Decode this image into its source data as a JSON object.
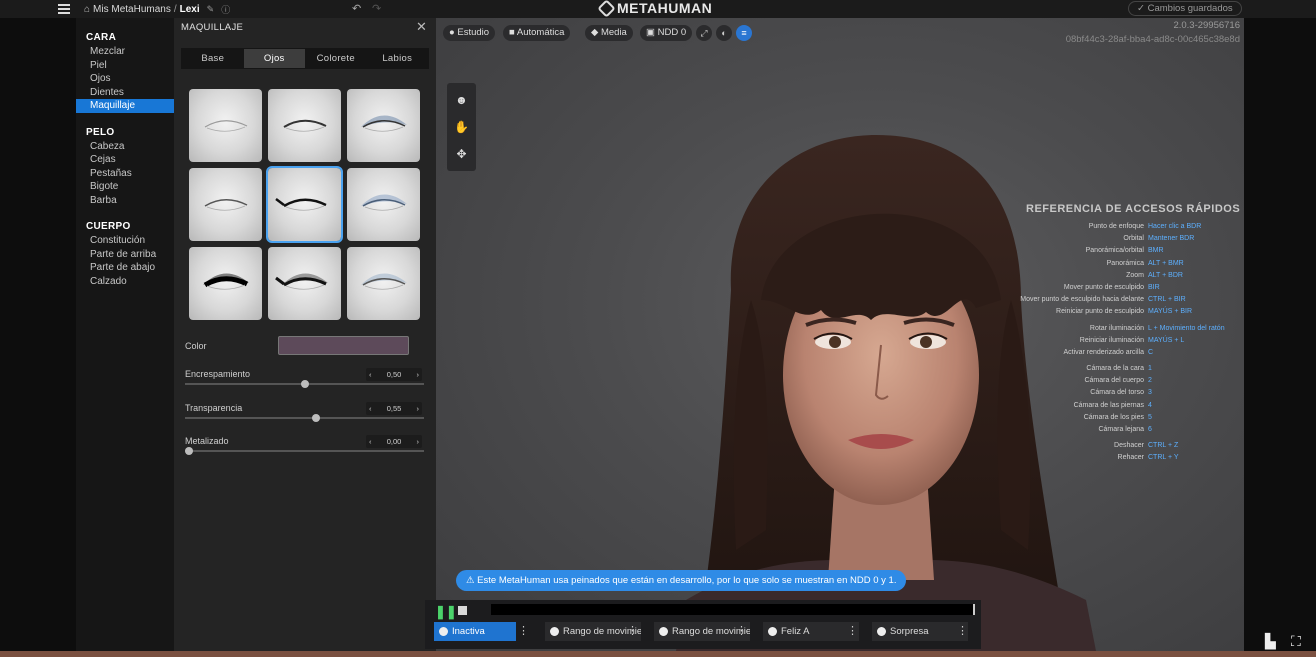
{
  "topbar": {
    "breadcrumb_home": "Mis MetaHumans",
    "breadcrumb_sep": "/",
    "breadcrumb_current": "Lexi",
    "logo": "METAHUMAN",
    "saved_status": "Cambios guardados"
  },
  "nav": {
    "sections": [
      {
        "title": "CARA",
        "items": [
          "Mezclar",
          "Piel",
          "Ojos",
          "Dientes",
          "Maquillaje"
        ]
      },
      {
        "title": "PELO",
        "items": [
          "Cabeza",
          "Cejas",
          "Pestañas",
          "Bigote",
          "Barba"
        ]
      },
      {
        "title": "CUERPO",
        "items": [
          "Constitución",
          "Parte de arriba",
          "Parte de abajo",
          "Calzado"
        ]
      }
    ],
    "active_item": "Maquillaje"
  },
  "panel": {
    "title": "MAQUILLAJE",
    "tabs": [
      "Base",
      "Ojos",
      "Colorete",
      "Labios"
    ],
    "active_tab": "Ojos",
    "selected_preset": 5,
    "color_label": "Color",
    "color_value": "#5d4a5a",
    "sliders": [
      {
        "label": "Encrespamiento",
        "value": "0,50",
        "fraction": 0.5
      },
      {
        "label": "Transparencia",
        "value": "0,55",
        "fraction": 0.55
      },
      {
        "label": "Metalizado",
        "value": "0,00",
        "fraction": 0.0
      }
    ]
  },
  "viewport": {
    "toolbar": {
      "studio": "Estudio",
      "auto": "Automática",
      "media": "Media",
      "ndd": "NDD 0"
    },
    "version": "2.0.3-29956716",
    "build_hash": "08bf44c3-28af-bba4-ad8c-00c465c38e8d",
    "shortcuts_title": "REFERENCIA DE ACCESOS RÁPIDOS",
    "shortcut_groups": [
      [
        {
          "action": "Punto de enfoque",
          "keys": "Hacer clic a BDR"
        },
        {
          "action": "Orbital",
          "keys": "Mantener BDR"
        },
        {
          "action": "Panorámica/orbital",
          "keys": "BMR"
        },
        {
          "action": "Panorámica",
          "keys": "ALT + BMR"
        },
        {
          "action": "Zoom",
          "keys": "ALT + BDR"
        },
        {
          "action": "Mover punto de esculpido",
          "keys": "BIR"
        },
        {
          "action": "Mover punto de esculpido hacia delante",
          "keys": "CTRL + BIR"
        },
        {
          "action": "Reiniciar punto de esculpido",
          "keys": "MAYÚS + BIR"
        }
      ],
      [
        {
          "action": "Rotar iluminación",
          "keys": "L + Movimiento del ratón"
        },
        {
          "action": "Reiniciar iluminación",
          "keys": "MAYÚS + L"
        },
        {
          "action": "Activar renderizado arcilla",
          "keys": "C"
        }
      ],
      [
        {
          "action": "Cámara de la cara",
          "keys": "1"
        },
        {
          "action": "Cámara del cuerpo",
          "keys": "2"
        },
        {
          "action": "Cámara del torso",
          "keys": "3"
        },
        {
          "action": "Cámara de las piernas",
          "keys": "4"
        },
        {
          "action": "Cámara de los pies",
          "keys": "5"
        },
        {
          "action": "Cámara lejana",
          "keys": "6"
        }
      ],
      [
        {
          "action": "Deshacer",
          "keys": "CTRL + Z"
        },
        {
          "action": "Rehacer",
          "keys": "CTRL + Y"
        }
      ]
    ],
    "notice": "Este MetaHuman usa peinados que están en desarrollo, por lo que solo se muestran en NDD 0 y 1."
  },
  "timeline": {
    "animations": [
      {
        "label": "Inactiva",
        "active": true
      },
      {
        "label": "Rango de movimiento facial",
        "active": false
      },
      {
        "label": "Rango de movimiento corporal",
        "active": false
      },
      {
        "label": "Feliz A",
        "active": false
      },
      {
        "label": "Sorpresa",
        "active": false
      }
    ]
  },
  "colors": {
    "accent": "#1877d6",
    "shortcut_key": "#5db0ff",
    "notice_bg": "#2f8be6",
    "play": "#4bd36b"
  }
}
